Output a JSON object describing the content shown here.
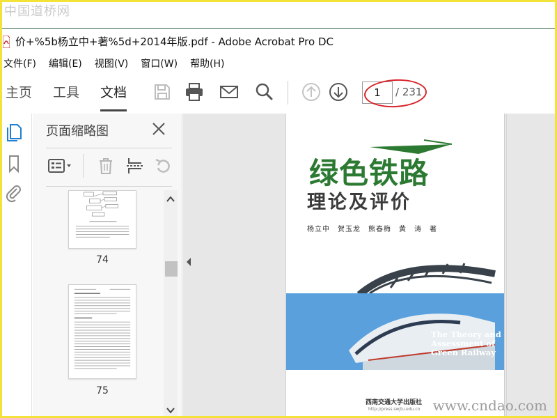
{
  "watermarks": {
    "top": "中国道桥网",
    "bottom": "www.cndao.com"
  },
  "window": {
    "title": "价+%5b杨立中+著%5d+2014年版.pdf - Adobe Acrobat Pro DC"
  },
  "menu": [
    {
      "label": "文件(F)"
    },
    {
      "label": "编辑(E)"
    },
    {
      "label": "视图(V)"
    },
    {
      "label": "窗口(W)"
    },
    {
      "label": "帮助(H)"
    }
  ],
  "tabs": [
    {
      "label": "主页"
    },
    {
      "label": "工具"
    },
    {
      "label": "文档"
    }
  ],
  "navigation": {
    "current_page": "1",
    "total_pages": "/ 231"
  },
  "panel": {
    "title": "页面缩略图",
    "thumbnails": [
      {
        "label": "74"
      },
      {
        "label": "75"
      }
    ]
  },
  "cover": {
    "title": "绿色铁路",
    "subtitle": "理论及评价",
    "authors": "杨立中　贺玉龙　熊春梅　黄　涛　著",
    "english_line1": "The Theory and",
    "english_line2": "Assessment of",
    "english_line3": "Green Railway",
    "publisher": "西南交通大学出版社",
    "url": "http://press.swjtu.edu.cn"
  },
  "colors": {
    "accent_blue": "#1f7fd0",
    "annotation_red": "#d7232a",
    "frame_yellow": "#f2e23a",
    "cover_green": "#2c7a32",
    "cover_blue": "#5aa0dd"
  }
}
